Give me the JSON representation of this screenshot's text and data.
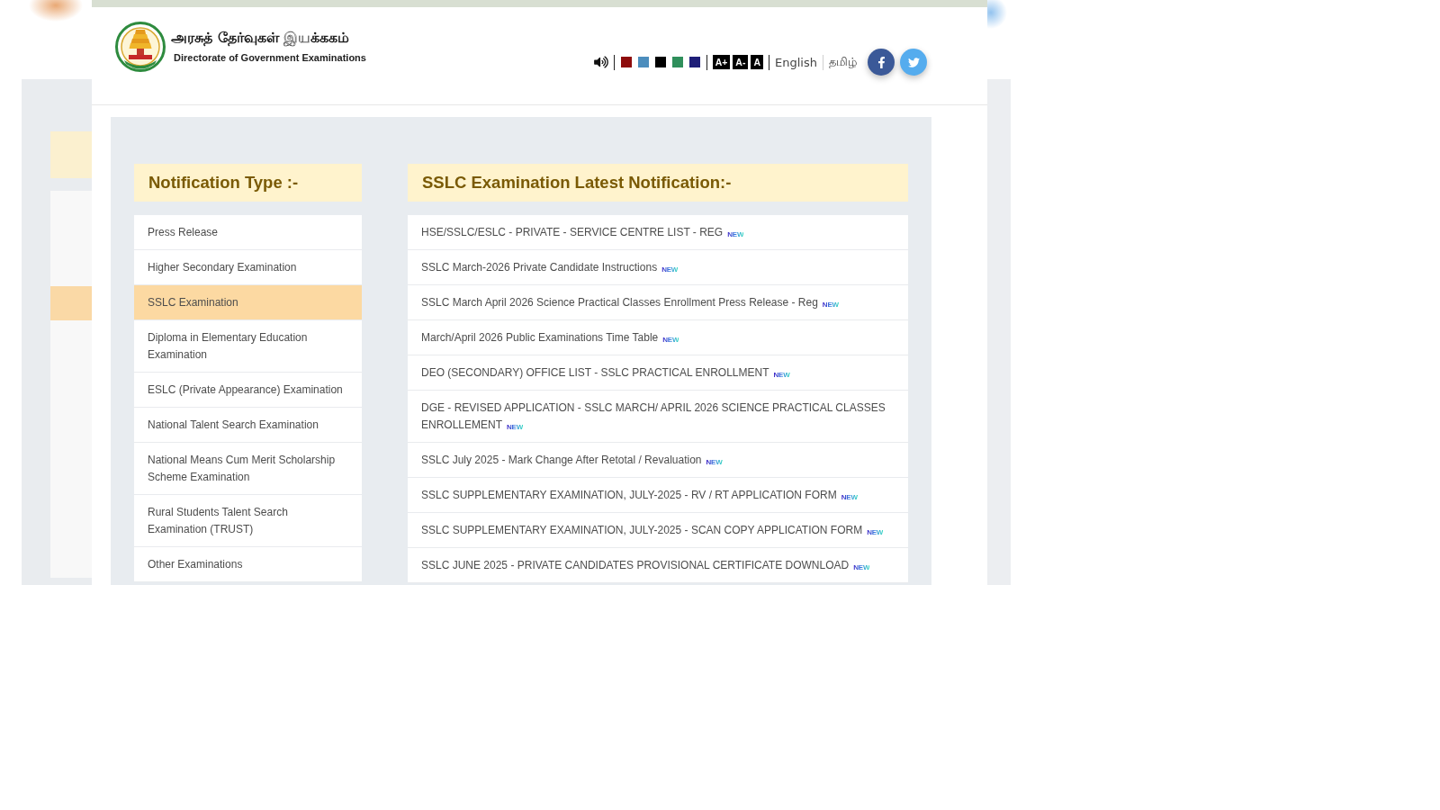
{
  "header": {
    "title": "அரசுத் தேர்வுகள் இயக்ககம்",
    "subtitle": "Directorate of Government Examinations"
  },
  "toolbar": {
    "color_themes": [
      {
        "color": "#8e0c0c"
      },
      {
        "color": "#4c8dbd"
      },
      {
        "color": "#000000"
      },
      {
        "color": "#2f8f5b"
      },
      {
        "color": "#1e1e78"
      }
    ],
    "font_sizes": [
      "A+",
      "A-",
      "A"
    ],
    "languages": [
      "English",
      "தமிழ்"
    ],
    "social": [
      {
        "kind": "facebook"
      },
      {
        "kind": "twitter"
      }
    ]
  },
  "notification_types": {
    "heading": "Notification Type :-",
    "items": [
      {
        "label": "Press Release",
        "selected": false
      },
      {
        "label": "Higher Secondary Examination",
        "selected": false
      },
      {
        "label": "SSLC Examination",
        "selected": true
      },
      {
        "label": "Diploma in Elementary Education Examination",
        "selected": false
      },
      {
        "label": "ESLC (Private Appearance) Examination",
        "selected": false
      },
      {
        "label": "National Talent Search Examination",
        "selected": false
      },
      {
        "label": "National Means Cum Merit Scholarship Scheme Examination",
        "selected": false
      },
      {
        "label": "Rural Students Talent Search Examination (TRUST)",
        "selected": false
      },
      {
        "label": "Other Examinations",
        "selected": false
      }
    ]
  },
  "latest_notifications": {
    "heading": "SSLC Examination Latest Notification:-",
    "items": [
      {
        "text": "HSE/SSLC/ESLC - PRIVATE - SERVICE CENTRE LIST - REG",
        "badge": "NEW"
      },
      {
        "text": "SSLC March-2026 Private Candidate Instructions",
        "badge": "NEW"
      },
      {
        "text": "SSLC March April 2026 Science Practical Classes Enrollment Press Release - Reg",
        "badge": "NEW"
      },
      {
        "text": "March/April 2026 Public Examinations Time Table",
        "badge": "NEW"
      },
      {
        "text": "DEO (SECONDARY) OFFICE LIST - SSLC PRACTICAL ENROLLMENT",
        "badge": "NEW"
      },
      {
        "text": "DGE - REVISED APPLICATION - SSLC MARCH/ APRIL 2026 SCIENCE PRACTICAL CLASSES ENROLLEMENT",
        "badge": "NEW"
      },
      {
        "text": "SSLC July 2025 - Mark Change After Retotal / Revaluation",
        "badge": "NEW"
      },
      {
        "text": "SSLC SUPPLEMENTARY EXAMINATION, JULY-2025 - RV / RT APPLICATION FORM",
        "badge": "NEW"
      },
      {
        "text": "SSLC SUPPLEMENTARY EXAMINATION, JULY-2025 - SCAN COPY APPLICATION FORM",
        "badge": "NEW"
      },
      {
        "text": "SSLC JUNE 2025 - PRIVATE CANDIDATES PROVISIONAL CERTIFICATE DOWNLOAD",
        "badge": "NEW"
      }
    ]
  }
}
